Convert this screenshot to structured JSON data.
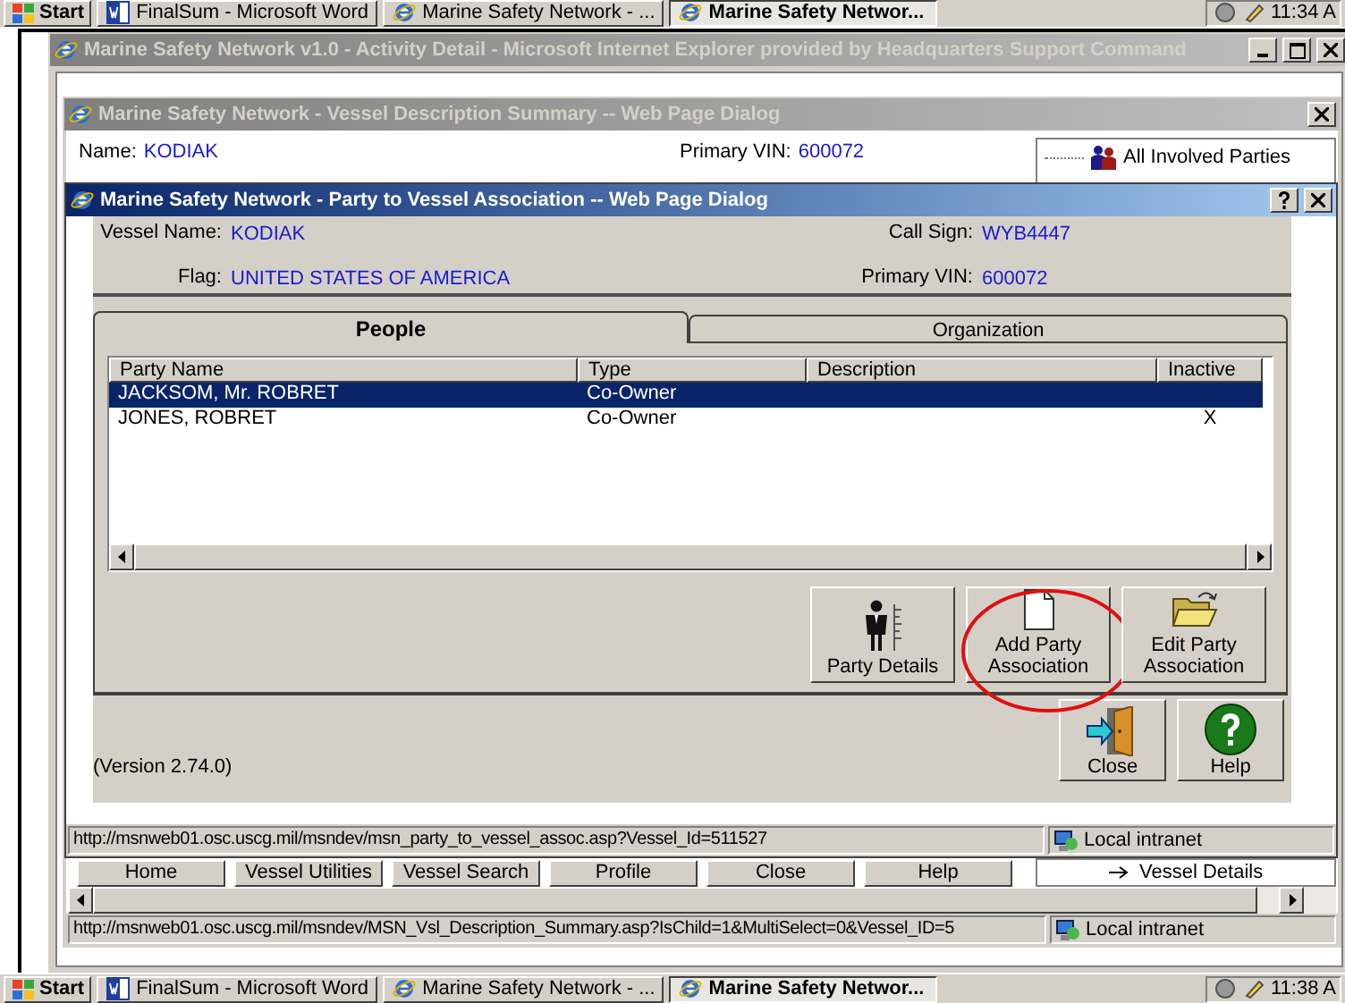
{
  "top_taskbar": {
    "start": "Start",
    "buttons": [
      {
        "label": "FinalSum - Microsoft Word",
        "kind": "word",
        "selected": false
      },
      {
        "label": "Marine Safety Network - ...",
        "kind": "ie",
        "selected": false
      },
      {
        "label": "Marine Safety Networ...",
        "kind": "ie",
        "selected": true
      }
    ],
    "clock": "11:34 A"
  },
  "browser_window": {
    "title": "Marine Safety Network v1.0 - Activity Detail - Microsoft Internet Explorer provided by Headquarters Support Command",
    "active": false
  },
  "summary_dialog": {
    "title": "Marine Safety Network - Vessel Description Summary -- Web Page Dialog",
    "active": false,
    "fields": [
      {
        "label": "Name:",
        "value": "KODIAK"
      },
      {
        "label": "Primary VIN:",
        "value": "600072"
      }
    ],
    "tree_items": [
      "All Involved Parties"
    ],
    "nav_buttons": [
      "Home",
      "Vessel Utilities",
      "Vessel Search",
      "Profile",
      "Close",
      "Help"
    ],
    "bottom_tree_items": [
      "Vessel Details"
    ],
    "status_url": "http://msnweb01.osc.uscg.mil/msndev/MSN_Vsl_Description_Summary.asp?IsChild=1&MultiSelect=0&Vessel_ID=5",
    "zone": "Local intranet"
  },
  "party_dialog": {
    "title": "Marine Safety Network - Party to Vessel Association -- Web Page Dialog",
    "active": true,
    "fields": [
      {
        "label": "Vessel Name:",
        "value": "KODIAK"
      },
      {
        "label": "Call Sign:",
        "value": "WYB4447"
      },
      {
        "label": "Flag:",
        "value": "UNITED STATES OF AMERICA"
      },
      {
        "label": "Primary VIN:",
        "value": "600072"
      }
    ],
    "tabs": [
      {
        "label": "People",
        "selected": true
      },
      {
        "label": "Organization",
        "selected": false
      }
    ],
    "table": {
      "columns": [
        "Party Name",
        "Type",
        "Description",
        "Inactive"
      ],
      "rows": [
        {
          "cells": [
            "JACKSOM, Mr. ROBRET",
            "Co-Owner",
            "",
            ""
          ],
          "selected": true
        },
        {
          "cells": [
            "JONES, ROBRET",
            "Co-Owner",
            "",
            "X"
          ],
          "selected": false
        }
      ]
    },
    "actions": [
      {
        "label": "Party Details",
        "kind": "person",
        "highlighted": false
      },
      {
        "label": "Add Party Association",
        "kind": "document",
        "highlighted": true
      },
      {
        "label": "Edit Party Association",
        "kind": "folder",
        "highlighted": false
      }
    ],
    "footer_buttons": [
      {
        "label": "Close",
        "kind": "exit"
      },
      {
        "label": "Help",
        "kind": "help"
      }
    ],
    "version": "(Version 2.74.0)",
    "status_url": "http://msnweb01.osc.uscg.mil/msndev/msn_party_to_vessel_assoc.asp?Vessel_Id=511527",
    "zone": "Local intranet"
  },
  "taskbar": {
    "start": "Start",
    "buttons": [
      {
        "label": "FinalSum - Microsoft Word",
        "kind": "word",
        "selected": false
      },
      {
        "label": "Marine Safety Network - ...",
        "kind": "ie",
        "selected": false
      },
      {
        "label": "Marine Safety Networ...",
        "kind": "ie",
        "selected": true
      }
    ],
    "clock": "11:38 A"
  }
}
